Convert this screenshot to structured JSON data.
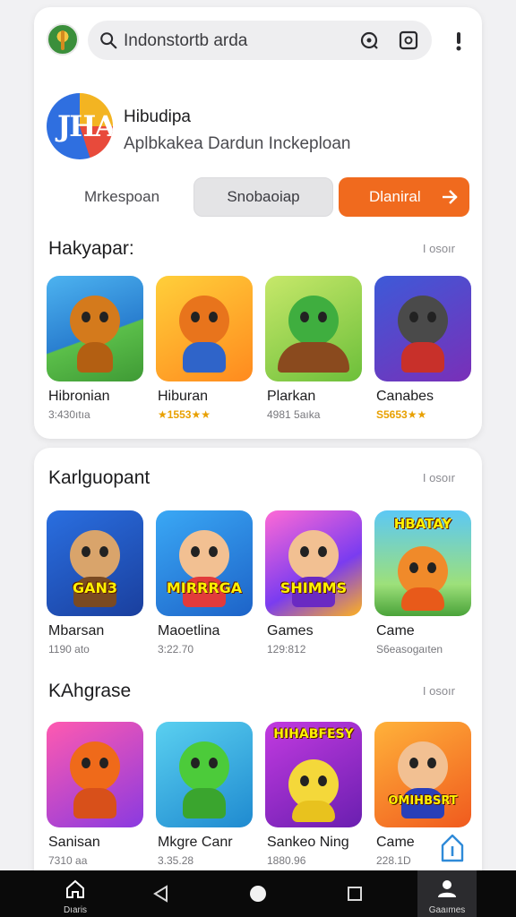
{
  "search": {
    "text": "Indonstortb arda"
  },
  "app": {
    "name": "Hibudipa",
    "subtitle": "Aplbkakea Dardun Inckeploan"
  },
  "actions": {
    "secondary_label": "Mrkespoan",
    "tertiary_label": "Snobaoiap",
    "primary_label": "Dlaniral"
  },
  "sections": [
    {
      "title": "Hakyapar:",
      "see_all": "I osoır",
      "items": [
        {
          "name": "Hibronian",
          "meta": "3:430ıtıa"
        },
        {
          "name": "Hiburan",
          "meta": "★1553★★"
        },
        {
          "name": "Plarkan",
          "meta": "4981 5aıka"
        },
        {
          "name": "Canabes",
          "meta": "S5653★★"
        }
      ]
    },
    {
      "title": "Karlguopant",
      "see_all": "I osoır",
      "items": [
        {
          "name": "Mbarsan",
          "meta": "1190 ato",
          "badge": "GAN3"
        },
        {
          "name": "Maoetlina",
          "meta": "3:22.70",
          "badge": "MIRRRGA"
        },
        {
          "name": "Games",
          "meta": "129:812",
          "badge": "SHIMMS"
        },
        {
          "name": "Came",
          "meta": "S6easogaıten",
          "badge": "HBATAY"
        }
      ]
    },
    {
      "title": "KAhgrase",
      "see_all": "I osoır",
      "items": [
        {
          "name": "Sanisan",
          "meta": "7310 aa"
        },
        {
          "name": "Mkgre Canr",
          "meta": "3.35.28"
        },
        {
          "name": "Sankeo Ning",
          "meta": "1880.96",
          "badge": "HIHABFESY"
        },
        {
          "name": "Came",
          "meta": "228.1D",
          "badge": "OMIHBSRT"
        }
      ]
    }
  ],
  "nav": {
    "home_label": "Dıaris",
    "profile_label": "Gaaımes"
  },
  "colors": {
    "accent": "#f06a1e",
    "rating": "#e8a000",
    "navbar": "#0a0a0a"
  }
}
